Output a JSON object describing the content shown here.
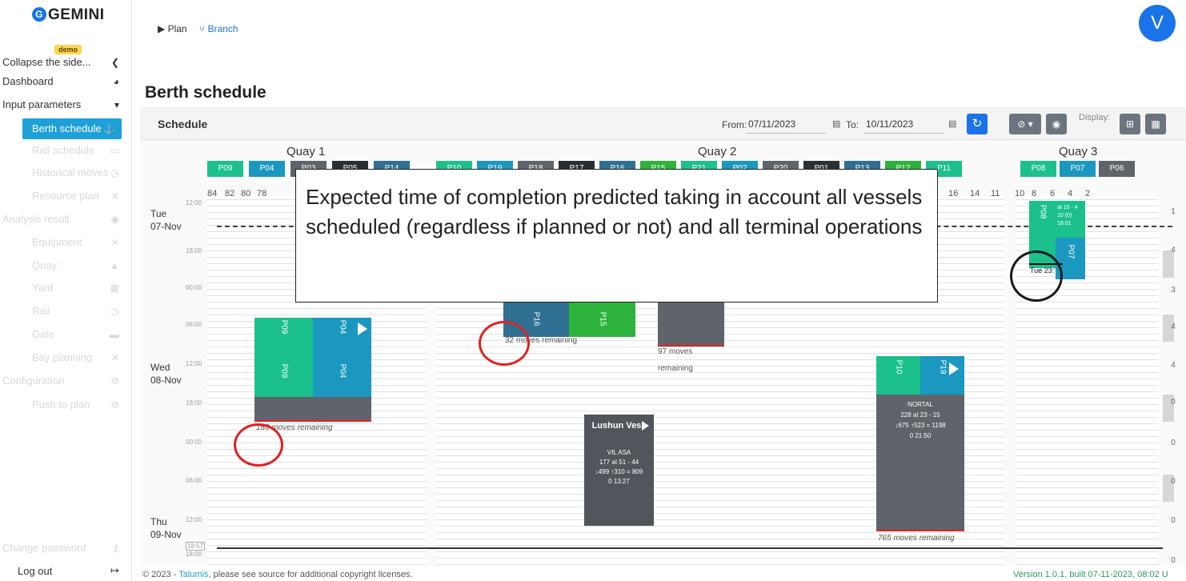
{
  "app": {
    "logo_text": "GEMINI",
    "logo_glyph": "G",
    "badge": "demo"
  },
  "sidebar": {
    "items": [
      {
        "label": "Collapse the side...",
        "icon": "collapse-icon",
        "glyph": "❮"
      },
      {
        "label": "Dashboard",
        "icon": "pie-chart-icon",
        "glyph": "◕"
      },
      {
        "label": "Input parameters",
        "icon": "chevron-down-icon",
        "glyph": "▾"
      },
      {
        "label": "Berth schedule",
        "icon": "anchor-icon",
        "glyph": "⚓"
      },
      {
        "label": "Rail schedule",
        "icon": "rail-icon",
        "glyph": "▭"
      },
      {
        "label": "Historical moves",
        "icon": "history-icon",
        "glyph": "◷"
      },
      {
        "label": "Resource plan",
        "icon": "tools-icon",
        "glyph": "✕"
      },
      {
        "label": "Analysis result",
        "icon": "result-icon",
        "glyph": "◉"
      },
      {
        "label": "Equipment",
        "icon": "equipment-icon",
        "glyph": "✕"
      },
      {
        "label": "Quay",
        "icon": "quay-icon",
        "glyph": "▲"
      },
      {
        "label": "Yard",
        "icon": "yard-icon",
        "glyph": "▦"
      },
      {
        "label": "Rail",
        "icon": "rail2-icon",
        "glyph": "◷"
      },
      {
        "label": "Gate",
        "icon": "truck-icon",
        "glyph": "▬"
      },
      {
        "label": "Bay planning",
        "icon": "bay-icon",
        "glyph": "✕"
      },
      {
        "label": "Configuration",
        "icon": "config-icon",
        "glyph": "⚙"
      },
      {
        "label": "Push to plan",
        "icon": "push-icon",
        "glyph": "⚙"
      },
      {
        "label": "Change password",
        "icon": "key-icon",
        "glyph": "⚷"
      }
    ],
    "logout_label": "Log out",
    "logout_glyph": "↦"
  },
  "topnav": {
    "tabs": [
      {
        "label": "▶ Plan",
        "icon": "play-icon"
      },
      {
        "label": "⑂ Branch",
        "icon": "branch-icon"
      }
    ],
    "avatar_initial": "V"
  },
  "page": {
    "title": "Berth schedule"
  },
  "toolbar": {
    "schedule_label": "Schedule",
    "from_label": "From:",
    "from_value": "07/11/2023",
    "to_label": "To:",
    "to_value": "10/11/2023",
    "display_label": "Display:",
    "refresh_glyph": "↻",
    "hide_glyph": "⊘ ▾",
    "eye_glyph": "◉",
    "grid1_glyph": "⊞",
    "grid2_glyph": "▦"
  },
  "colors": {
    "green": "#1cc08d",
    "teal": "#1a98c0",
    "grey": "#5e6469",
    "black": "#2b2f33",
    "darkblue": "#2e6f92",
    "brightgreen": "#2db23c",
    "active": "#1ea0d8"
  },
  "quays": [
    {
      "name": "Quay 1",
      "berths": [
        {
          "code": "P09",
          "c": "green"
        },
        {
          "code": "P04",
          "c": "teal"
        },
        {
          "code": "P03",
          "c": "grey"
        },
        {
          "code": "P05",
          "c": "black"
        },
        {
          "code": "P14",
          "c": "darkblue"
        }
      ]
    },
    {
      "name": "Quay 2",
      "berths": [
        {
          "code": "P10",
          "c": "green"
        },
        {
          "code": "P19",
          "c": "teal"
        },
        {
          "code": "P18",
          "c": "grey"
        },
        {
          "code": "P17",
          "c": "black"
        },
        {
          "code": "P16",
          "c": "darkblue"
        },
        {
          "code": "P15",
          "c": "brightgreen"
        },
        {
          "code": "P21",
          "c": "green"
        },
        {
          "code": "P02",
          "c": "teal"
        },
        {
          "code": "P20",
          "c": "grey"
        },
        {
          "code": "P01",
          "c": "black"
        },
        {
          "code": "P13",
          "c": "darkblue"
        },
        {
          "code": "P12",
          "c": "brightgreen"
        },
        {
          "code": "P11",
          "c": "green"
        }
      ]
    },
    {
      "name": "Quay 3",
      "berths": [
        {
          "code": "P08",
          "c": "green"
        },
        {
          "code": "P07",
          "c": "teal"
        },
        {
          "code": "P06",
          "c": "grey"
        }
      ]
    }
  ],
  "positions": {
    "left": [
      "84",
      "82",
      "80",
      "78"
    ],
    "right": [
      "16",
      "14",
      "11",
      "10",
      "8",
      "6",
      "4",
      "2"
    ]
  },
  "time_labels": [
    "12:00",
    "18:00",
    "00:00",
    "06:00",
    "12:00",
    "18:00",
    "00:00",
    "06:00",
    "12:00",
    "18:57",
    "18:00"
  ],
  "days": [
    {
      "dow": "Tue",
      "date": "07-Nov"
    },
    {
      "dow": "Wed",
      "date": "08-Nov"
    },
    {
      "dow": "Thu",
      "date": "09-Nov"
    }
  ],
  "right_column": [
    "1",
    "4",
    "3",
    "4",
    "4",
    "0",
    "0",
    "0",
    "0",
    "0"
  ],
  "vessels": {
    "v1": {
      "a": "P09",
      "b": "P04",
      "a2": "P09",
      "b2": "P04",
      "remaining": "180 moves remaining"
    },
    "v2": {
      "a": "P16",
      "b": "P15",
      "remaining": "32 moves remaining"
    },
    "v3": {
      "remaining1": "97 moves",
      "remaining2": "remaining"
    },
    "v4": {
      "a": "P10",
      "b": "P19",
      "name": "NORTAL",
      "l1": "228 at 23 - 15",
      "l2": "↓675 ↑523 = 1198",
      "l3": "0 21:50",
      "remaining": "765 moves remaining"
    },
    "v5": {
      "name": "Lushun Vess",
      "l1": "VIL ASA",
      "l2": "177 at 51 - 44",
      "l3": "↓499 ↑310 = 809",
      "l4": "0 13:27"
    },
    "v6": {
      "a": "P08",
      "b": "P07",
      "l1": "at 10 - 4",
      "l2": "10 (0)",
      "l3": "18:01",
      "etc": "Tue 23:"
    }
  },
  "callout": "Expected time of completion predicted taking in account all vessels scheduled (regardless if planned or not) and all terminal operations",
  "footer": {
    "copy_prefix": "© 2023 - ",
    "copy_link": "Talumis",
    "copy_suffix": ", please see source for additional copyright licenses.",
    "version": "Version 1.0.1, built 07-11-2023, 08:02 U"
  }
}
